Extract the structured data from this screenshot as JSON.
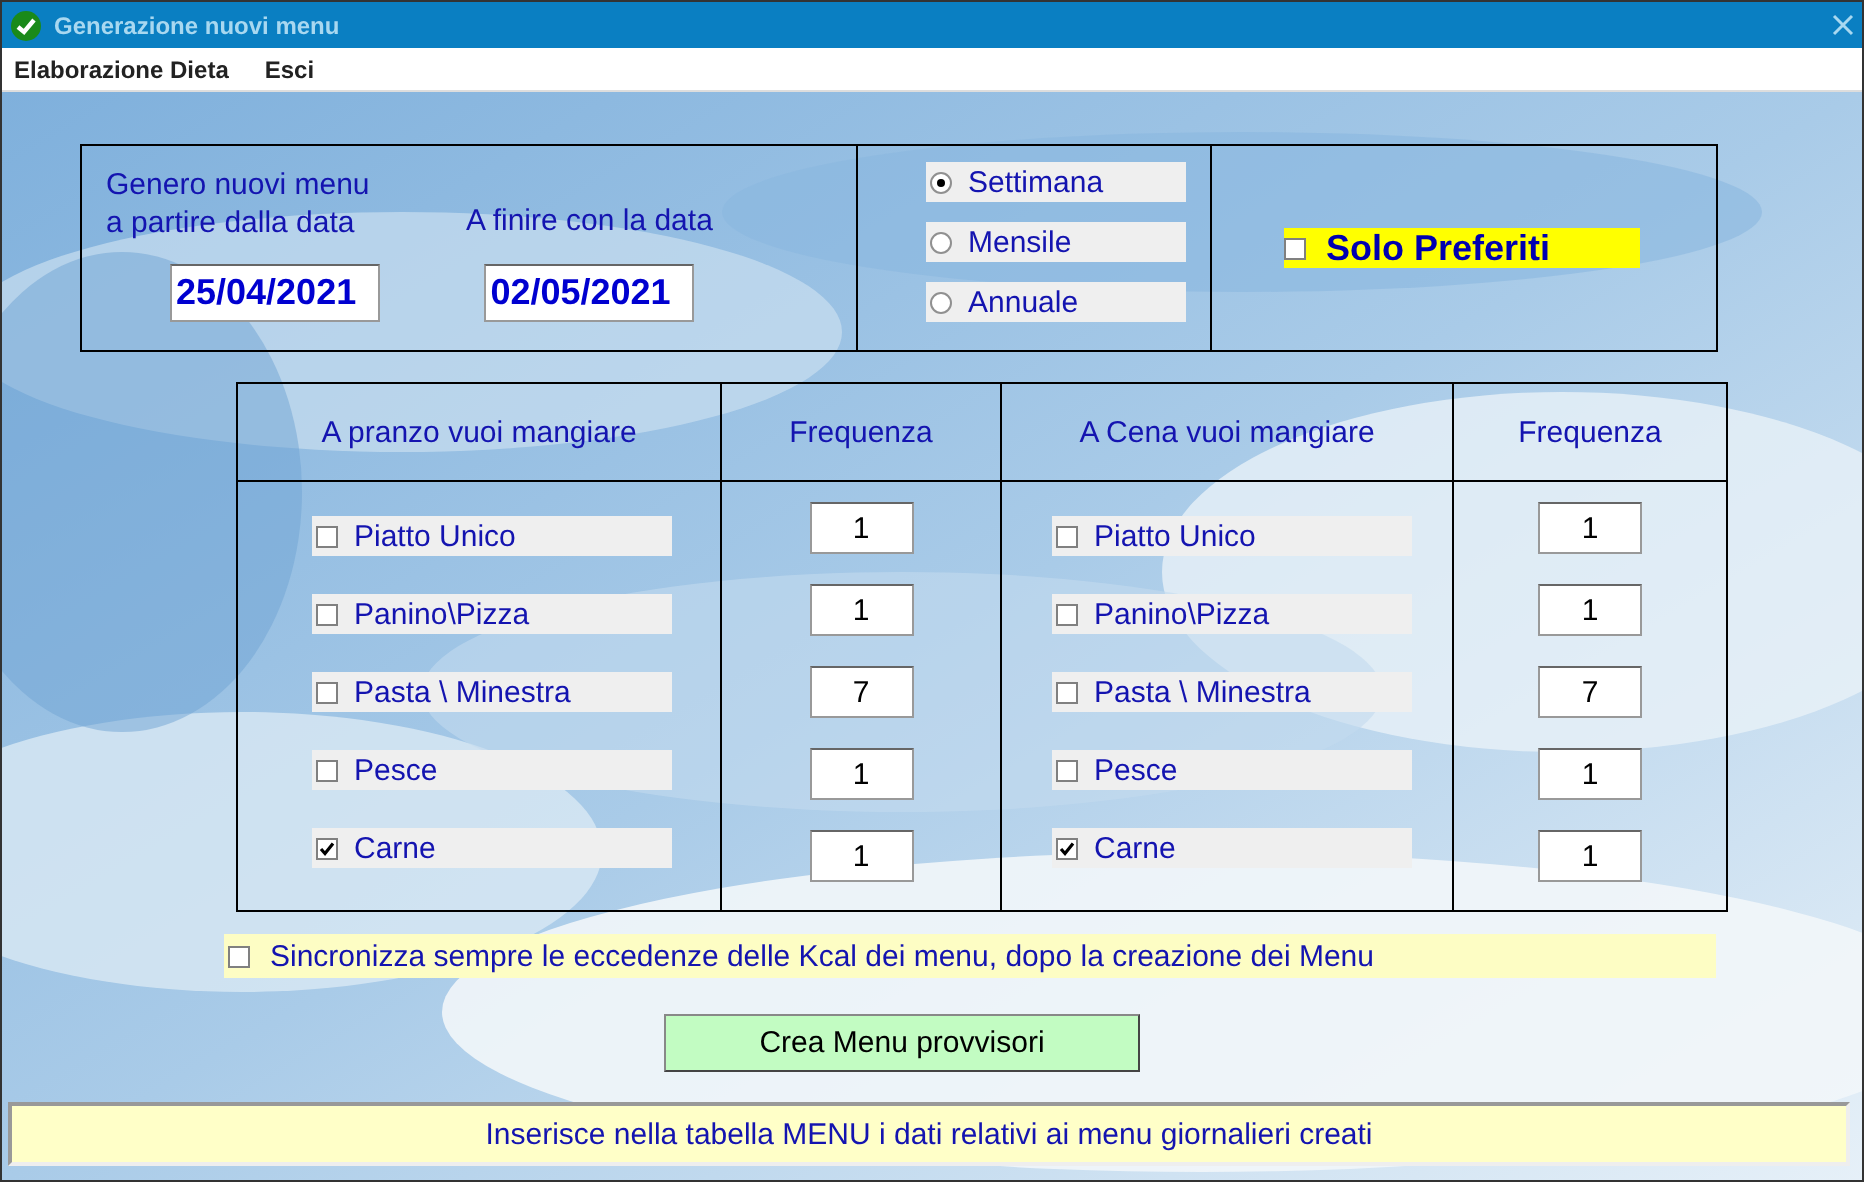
{
  "window": {
    "title": "Generazione nuovi menu"
  },
  "menu": [
    "Elaborazione Dieta",
    "Esci"
  ],
  "dates": [
    {
      "label": "Genero nuovi menu\na partire dalla data",
      "value": "25/04/2021"
    },
    {
      "label": "A finire con la data",
      "value": "02/05/2021"
    }
  ],
  "period": [
    {
      "label": "Settimana",
      "selected": true
    },
    {
      "label": "Mensile",
      "selected": false
    },
    {
      "label": "Annuale",
      "selected": false
    }
  ],
  "favorites": {
    "label": "Solo Preferiti",
    "checked": false
  },
  "meals": [
    {
      "title": "A pranzo vuoi mangiare",
      "frequency_title": "Frequenza",
      "items": [
        {
          "label": "Piatto Unico",
          "checked": false,
          "frequency": "1"
        },
        {
          "label": "Panino\\Pizza",
          "checked": false,
          "frequency": "1"
        },
        {
          "label": "Pasta \\ Minestra",
          "checked": false,
          "frequency": "7"
        },
        {
          "label": "Pesce",
          "checked": false,
          "frequency": "1"
        },
        {
          "label": "Carne",
          "checked": true,
          "frequency": "1"
        }
      ]
    },
    {
      "title": "A Cena vuoi mangiare",
      "frequency_title": "Frequenza",
      "items": [
        {
          "label": "Piatto Unico",
          "checked": false,
          "frequency": "1"
        },
        {
          "label": "Panino\\Pizza",
          "checked": false,
          "frequency": "1"
        },
        {
          "label": "Pasta \\ Minestra",
          "checked": false,
          "frequency": "7"
        },
        {
          "label": "Pesce",
          "checked": false,
          "frequency": "1"
        },
        {
          "label": "Carne",
          "checked": true,
          "frequency": "1"
        }
      ]
    }
  ],
  "sync": {
    "label": "Sincronizza sempre le eccedenze delle  Kcal dei menu, dopo la creazione dei Menu",
    "checked": false
  },
  "button": "Crea Menu provvisori",
  "status_bar": "Inserisce nella tabella MENU i dati relativi ai menu giornalieri creati"
}
